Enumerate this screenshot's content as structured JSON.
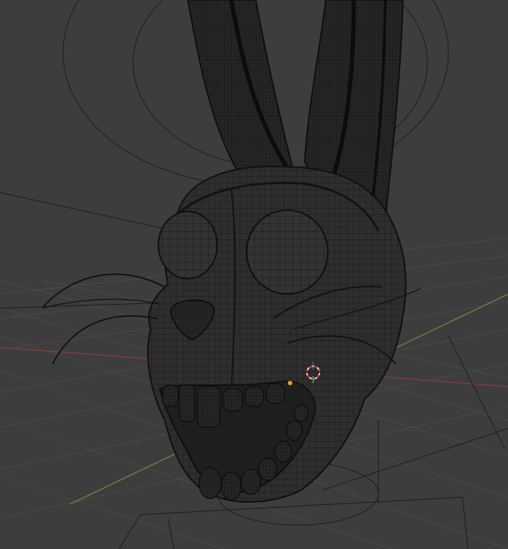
{
  "app": {
    "view": "3D Viewport",
    "shading": "wireframe",
    "object": "rabbit-head-mesh"
  },
  "colors": {
    "background": "#3d3d3d",
    "grid_line": "#4a4a4a",
    "x_axis": "#8a3a3a",
    "y_axis": "#6a8a3a",
    "wire": "#111111",
    "wire_fill": "#2d2d2d",
    "wire_dense": "#1a1a1a",
    "cursor_red": "#e03030",
    "cursor_white": "#f0f0f0",
    "origin_orange": "#f0a020",
    "gizmo_blue": "#4060e0",
    "gizmo_green": "#60c060"
  },
  "icons": {
    "cursor": "3d-cursor-icon",
    "origin": "object-origin-icon"
  }
}
